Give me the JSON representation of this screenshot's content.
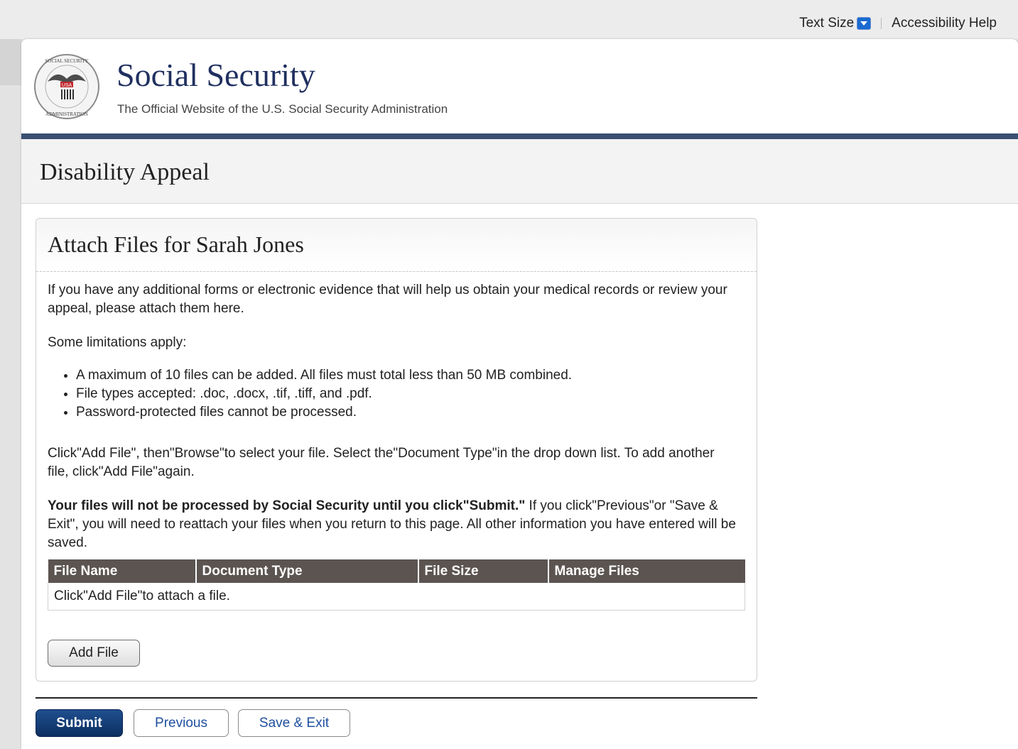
{
  "utility_bar": {
    "text_size_label": "Text Size",
    "accessibility_help_label": "Accessibility Help"
  },
  "header": {
    "site_title": "Social Security",
    "site_subtitle": "The Official Website of the U.S. Social Security Administration",
    "seal_text_top": "SOCIAL SECURITY",
    "seal_text_bottom": "ADMINISTRATION",
    "seal_text_center": "USA"
  },
  "page": {
    "title": "Disability Appeal"
  },
  "panel": {
    "title": "Attach Files for Sarah Jones",
    "intro": "If you have any additional forms or electronic evidence that will help us obtain your medical records or review your appeal, please attach them here.",
    "limitations_heading": "Some limitations apply:",
    "limitations": [
      "A maximum of 10 files can be added. All files must total less than 50 MB combined.",
      "File types accepted: .doc, .docx, .tif, .tiff, and .pdf.",
      "Password-protected files cannot be processed."
    ],
    "instructions": "Click\"Add File\", then\"Browse\"to select your file. Select the\"Document Type\"in the drop down list. To add another file, click\"Add File\"again.",
    "warning_bold": "Your files will not be processed by Social Security until you click\"Submit.\"",
    "warning_rest": " If you click\"Previous\"or \"Save & Exit\", you will need to reattach your files when you return to this page. All other information you have entered will be saved.",
    "table": {
      "columns": [
        "File Name",
        "Document Type",
        "File Size",
        "Manage Files"
      ],
      "empty_message": "Click\"Add File\"to attach a file."
    },
    "add_file_label": "Add File"
  },
  "actions": {
    "submit_label": "Submit",
    "previous_label": "Previous",
    "save_exit_label": "Save & Exit"
  },
  "colors": {
    "brand_navy": "#1f2f5f",
    "header_rule": "#3b4f73",
    "table_header": "#5b5451",
    "submit_bg": "#0d2f60",
    "link_blue": "#1f4fa0"
  }
}
